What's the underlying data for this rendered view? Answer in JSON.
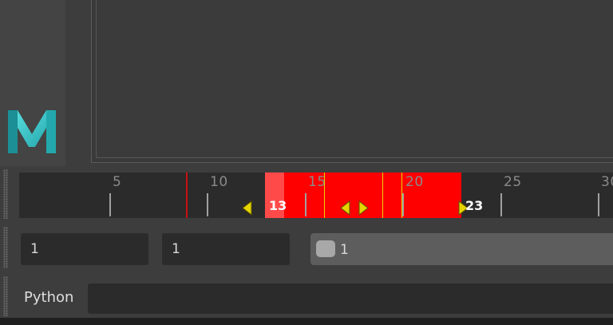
{
  "timeline": {
    "major_ticks": [
      "5",
      "10",
      "15",
      "20",
      "25",
      "30"
    ],
    "current_frame": "13",
    "range_end_frame": "23"
  },
  "range_slider": {
    "start_field": "1",
    "playback_start_field": "1",
    "bar_label": "1"
  },
  "command_line": {
    "language": "Python",
    "value": ""
  },
  "colors": {
    "playback_range": "#ff0000",
    "key_marker": "#e6d400",
    "logo": "#2fc6c9"
  }
}
